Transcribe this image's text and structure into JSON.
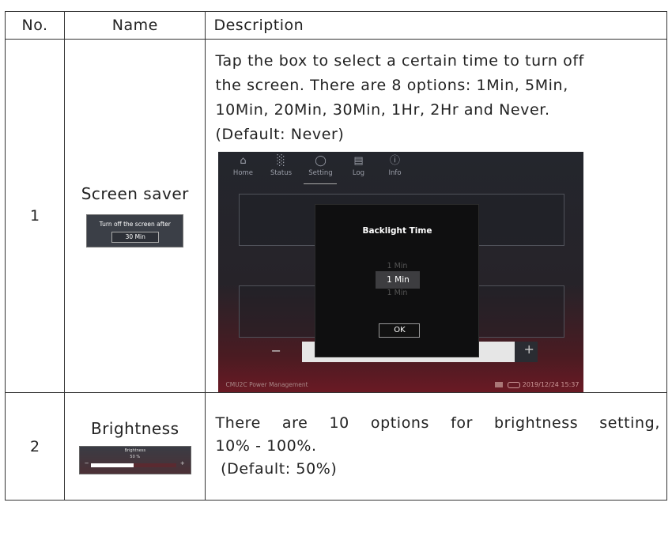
{
  "table": {
    "headers": {
      "no": "No.",
      "name": "Name",
      "description": "Description"
    },
    "rows": [
      {
        "no": "1",
        "name": "Screen saver",
        "thumb": {
          "line1": "Turn off the screen after",
          "line2": "30 Min"
        },
        "description_lines": [
          "Tap the box to select a certain time to turn off",
          "the screen. There are 8 options: 1Min, 5Min,",
          "10Min, 20Min, 30Min, 1Hr, 2Hr and Never.",
          "(Default: Never)"
        ],
        "screen": {
          "nav": [
            "Home",
            "Status",
            "Setting",
            "Log",
            "Info"
          ],
          "active_nav": "Setting",
          "dialog_title": "Backlight Time",
          "picker": {
            "prev": "1 Min",
            "selected": "1 Min",
            "next": "1 Min"
          },
          "ok": "OK",
          "minus": "−",
          "plus": "+",
          "slider_level": 0.9,
          "footer_left": "CMU2C Power Management",
          "footer_right": "2019/12/24 15:37"
        }
      },
      {
        "no": "2",
        "name": "Brightness",
        "thumb": {
          "title": "Brightness",
          "value": "50 %",
          "level": 0.5,
          "minus": "−",
          "plus": "+"
        },
        "description_lines": [
          "There are 10 options for brightness setting,",
          "10% - 100%.",
          " (Default: 50%)"
        ]
      }
    ]
  }
}
